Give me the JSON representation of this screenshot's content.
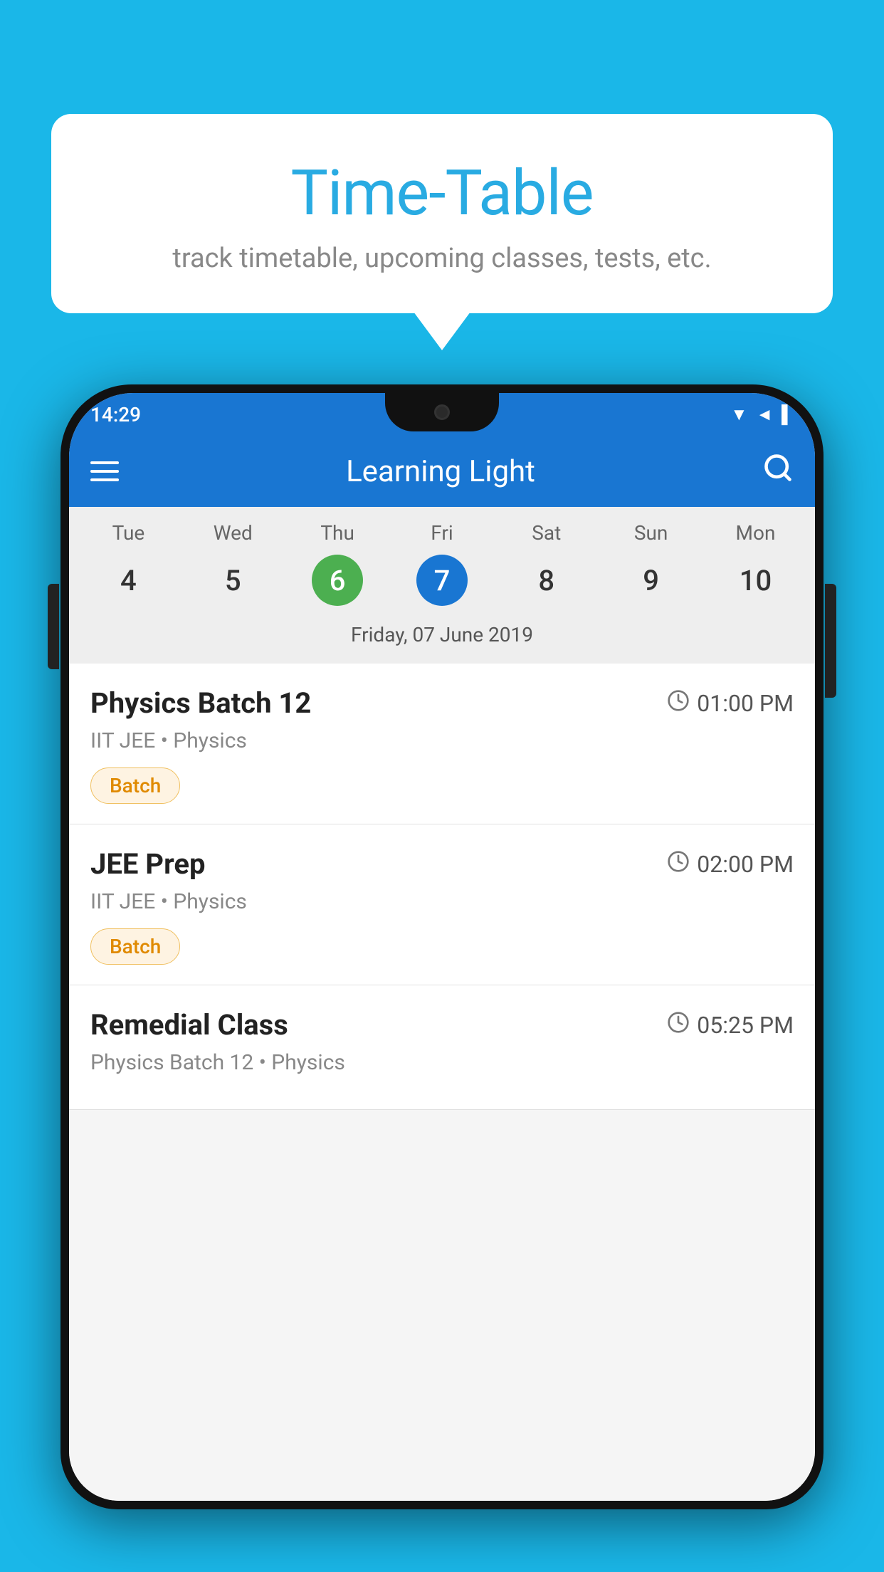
{
  "background_color": "#1ab7e8",
  "speech_bubble": {
    "title": "Time-Table",
    "subtitle": "track timetable, upcoming classes, tests, etc."
  },
  "phone": {
    "status_bar": {
      "time": "14:29",
      "icons": [
        "wifi",
        "signal",
        "battery"
      ]
    },
    "app_bar": {
      "title": "Learning Light",
      "menu_icon": "hamburger-icon",
      "search_icon": "search-icon"
    },
    "calendar": {
      "days": [
        {
          "name": "Tue",
          "num": "4",
          "state": "normal"
        },
        {
          "name": "Wed",
          "num": "5",
          "state": "normal"
        },
        {
          "name": "Thu",
          "num": "6",
          "state": "today"
        },
        {
          "name": "Fri",
          "num": "7",
          "state": "selected"
        },
        {
          "name": "Sat",
          "num": "8",
          "state": "normal"
        },
        {
          "name": "Sun",
          "num": "9",
          "state": "normal"
        },
        {
          "name": "Mon",
          "num": "10",
          "state": "normal"
        }
      ],
      "selected_date_label": "Friday, 07 June 2019"
    },
    "classes": [
      {
        "title": "Physics Batch 12",
        "time": "01:00 PM",
        "subtitle": "IIT JEE • Physics",
        "badge": "Batch"
      },
      {
        "title": "JEE Prep",
        "time": "02:00 PM",
        "subtitle": "IIT JEE • Physics",
        "badge": "Batch"
      },
      {
        "title": "Remedial Class",
        "time": "05:25 PM",
        "subtitle": "Physics Batch 12 • Physics",
        "badge": ""
      }
    ]
  }
}
